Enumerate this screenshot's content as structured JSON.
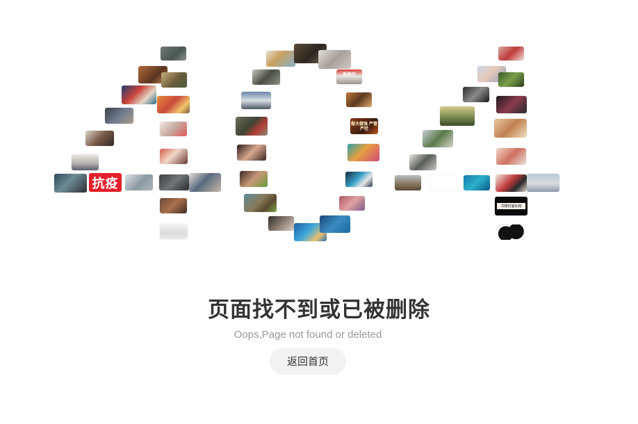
{
  "error": {
    "title": "页面找不到或已被删除",
    "subtitle": "Oops,Page not found or deleted",
    "home_button": "返回首页"
  },
  "collage": {
    "thumb_captions": {
      "kangyi": "抗疫",
      "boxing": "做大做强 严管严控",
      "pink_sign": "新時代",
      "book_cover": "书籍封面标题",
      "pale": "···"
    }
  },
  "colors": {
    "title": "#333333",
    "subtitle": "#999999",
    "button_bg": "#f2f2f2",
    "kangyi_red": "#e5202b"
  }
}
